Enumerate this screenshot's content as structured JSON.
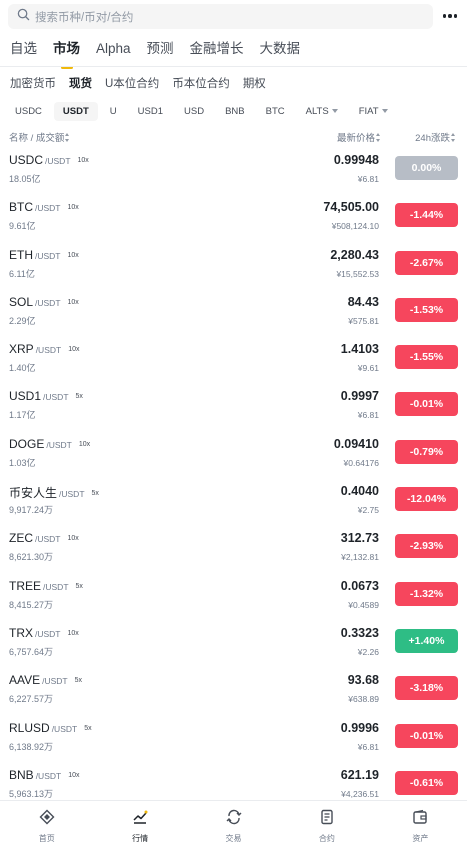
{
  "search": {
    "placeholder": "搜索币种/币对/合约"
  },
  "main_tabs": [
    "自选",
    "市场",
    "Alpha",
    "预测",
    "金融增长",
    "大数据"
  ],
  "sub_tabs": [
    "加密货币",
    "现货",
    "U本位合约",
    "币本位合约",
    "期权"
  ],
  "quote_chips": [
    "USDC",
    "USDT",
    "U",
    "USD1",
    "USD",
    "BNB",
    "BTC",
    "ALTS",
    "FIAT"
  ],
  "columns": {
    "name": "名称 / 成交额",
    "price": "最新价格",
    "change": "24h涨跌"
  },
  "colors": {
    "up": "#2ebd85",
    "down": "#f6465d",
    "flat": "#b7bdc6",
    "accent": "#f0b90b"
  },
  "rows": [
    {
      "base": "USDC",
      "quote": "/USDT",
      "lev": "10x",
      "vol": "18.05亿",
      "price": "0.99948",
      "fiat": "¥6.81",
      "change": "0.00%",
      "dir": "flat"
    },
    {
      "base": "BTC",
      "quote": "/USDT",
      "lev": "10x",
      "vol": "9.61亿",
      "price": "74,505.00",
      "fiat": "¥508,124.10",
      "change": "-1.44%",
      "dir": "down"
    },
    {
      "base": "ETH",
      "quote": "/USDT",
      "lev": "10x",
      "vol": "6.11亿",
      "price": "2,280.43",
      "fiat": "¥15,552.53",
      "change": "-2.67%",
      "dir": "down"
    },
    {
      "base": "SOL",
      "quote": "/USDT",
      "lev": "10x",
      "vol": "2.29亿",
      "price": "84.43",
      "fiat": "¥575.81",
      "change": "-1.53%",
      "dir": "down"
    },
    {
      "base": "XRP",
      "quote": "/USDT",
      "lev": "10x",
      "vol": "1.40亿",
      "price": "1.4103",
      "fiat": "¥9.61",
      "change": "-1.55%",
      "dir": "down"
    },
    {
      "base": "USD1",
      "quote": "/USDT",
      "lev": "5x",
      "vol": "1.17亿",
      "price": "0.9997",
      "fiat": "¥6.81",
      "change": "-0.01%",
      "dir": "down"
    },
    {
      "base": "DOGE",
      "quote": "/USDT",
      "lev": "10x",
      "vol": "1.03亿",
      "price": "0.09410",
      "fiat": "¥0.64176",
      "change": "-0.79%",
      "dir": "down"
    },
    {
      "base": "币安人生",
      "quote": "/USDT",
      "lev": "5x",
      "vol": "9,917.24万",
      "price": "0.4040",
      "fiat": "¥2.75",
      "change": "-12.04%",
      "dir": "down"
    },
    {
      "base": "ZEC",
      "quote": "/USDT",
      "lev": "10x",
      "vol": "8,621.30万",
      "price": "312.73",
      "fiat": "¥2,132.81",
      "change": "-2.93%",
      "dir": "down"
    },
    {
      "base": "TREE",
      "quote": "/USDT",
      "lev": "5x",
      "vol": "8,415.27万",
      "price": "0.0673",
      "fiat": "¥0.4589",
      "change": "-1.32%",
      "dir": "down"
    },
    {
      "base": "TRX",
      "quote": "/USDT",
      "lev": "10x",
      "vol": "6,757.64万",
      "price": "0.3323",
      "fiat": "¥2.26",
      "change": "+1.40%",
      "dir": "up"
    },
    {
      "base": "AAVE",
      "quote": "/USDT",
      "lev": "5x",
      "vol": "6,227.57万",
      "price": "93.68",
      "fiat": "¥638.89",
      "change": "-3.18%",
      "dir": "down"
    },
    {
      "base": "RLUSD",
      "quote": "/USDT",
      "lev": "5x",
      "vol": "6,138.92万",
      "price": "0.9996",
      "fiat": "¥6.81",
      "change": "-0.01%",
      "dir": "down"
    },
    {
      "base": "BNB",
      "quote": "/USDT",
      "lev": "10x",
      "vol": "5,963.13万",
      "price": "621.19",
      "fiat": "¥4,236.51",
      "change": "-0.61%",
      "dir": "down"
    }
  ],
  "bottom_nav": [
    {
      "label": "首页",
      "icon": "home-icon"
    },
    {
      "label": "行情",
      "icon": "markets-icon"
    },
    {
      "label": "交易",
      "icon": "trade-icon"
    },
    {
      "label": "合约",
      "icon": "futures-icon"
    },
    {
      "label": "资产",
      "icon": "wallet-icon"
    }
  ]
}
